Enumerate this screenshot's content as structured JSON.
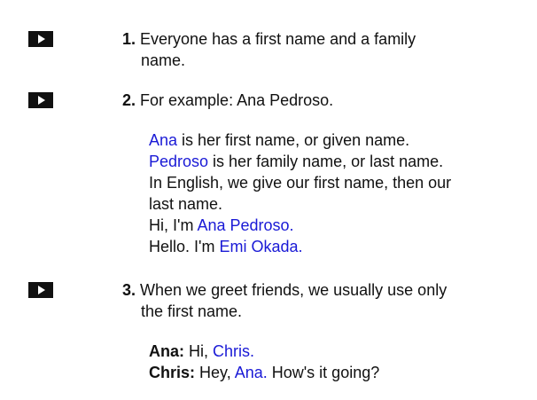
{
  "items": [
    {
      "number": "1.",
      "line1": "Everyone has a first name and a family",
      "line2": "name."
    },
    {
      "number": "2.",
      "text": "For example: Ana Pedroso."
    },
    {
      "number": "3.",
      "line1": "When we greet friends, we usually use only",
      "line2": "the first name."
    }
  ],
  "explanation": {
    "l1_name": "Ana",
    "l1_rest": " is her first name, or given name.",
    "l2_name": "Pedroso",
    "l2_rest": " is her family name, or last name.",
    "l3": "In English, we give our first name, then our",
    "l4": "last name.",
    "l5_pre": "Hi, I'm ",
    "l5_name": "Ana Pedroso.",
    "l6_pre": "Hello. I'm ",
    "l6_name": "Emi Okada."
  },
  "dialogue": {
    "s1_speaker": "Ana:",
    "s1_pre": " Hi, ",
    "s1_name": "Chris.",
    "s2_speaker": "Chris:",
    "s2_pre": " Hey, ",
    "s2_name": "Ana.",
    "s2_rest": " How's it going?"
  },
  "colors": {
    "highlight": "#1a1ad6",
    "text": "#111111",
    "button": "#111111"
  },
  "icons": {
    "play": "play-icon"
  }
}
